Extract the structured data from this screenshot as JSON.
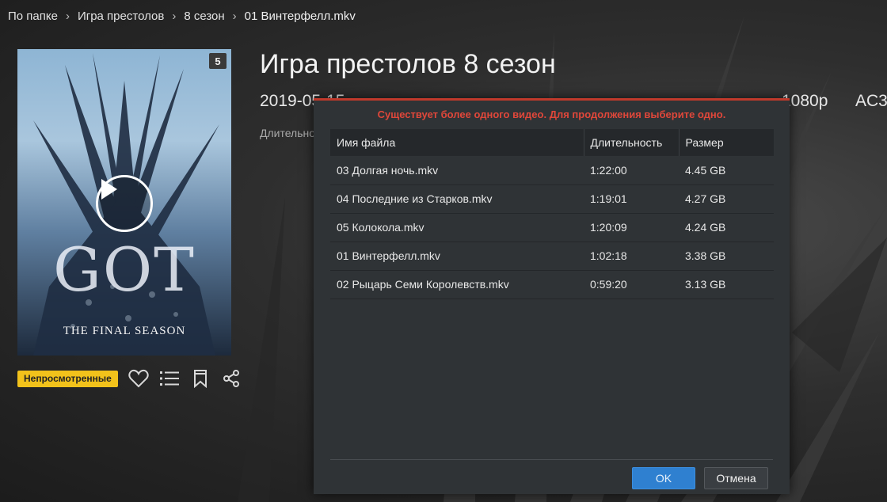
{
  "breadcrumb": {
    "items": [
      "По папке",
      "Игра престолов",
      "8 сезон",
      "01 Винтерфелл.mkv"
    ]
  },
  "poster": {
    "badge": "5",
    "logo_text": "GOT",
    "tagline": "THE FINAL SEASON"
  },
  "actions": {
    "status_tag": "Непросмотренные"
  },
  "details": {
    "title": "Игра престолов 8 сезон",
    "date": "2019-05-15",
    "resolution": "1080p",
    "audio": "AC3",
    "duration_label": "Длительно"
  },
  "dialog": {
    "warning": "Существует более одного видео. Для продолжения выберите одно.",
    "columns": {
      "name": "Имя файла",
      "duration": "Длительность",
      "size": "Размер"
    },
    "rows": [
      {
        "name": "03 Долгая ночь.mkv",
        "duration": "1:22:00",
        "size": "4.45 GB"
      },
      {
        "name": "04 Последние из Старков.mkv",
        "duration": "1:19:01",
        "size": "4.27 GB"
      },
      {
        "name": "05 Колокола.mkv",
        "duration": "1:20:09",
        "size": "4.24 GB"
      },
      {
        "name": "01 Винтерфелл.mkv",
        "duration": "1:02:18",
        "size": "3.38 GB"
      },
      {
        "name": "02 Рыцарь Семи Королевств.mkv",
        "duration": "0:59:20",
        "size": "3.13 GB"
      }
    ],
    "ok_label": "OK",
    "cancel_label": "Отмена"
  },
  "colors": {
    "accent": "#2f80d0",
    "warning": "#e0473a",
    "tag": "#f2c21b"
  },
  "icons": [
    "chevron-right-icon",
    "play-icon",
    "heart-icon",
    "list-icon",
    "bookmark-icon",
    "share-icon"
  ]
}
